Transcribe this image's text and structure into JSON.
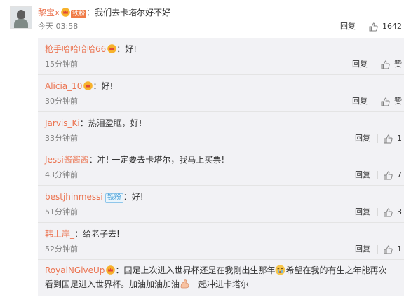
{
  "main_comment": {
    "username": "黎宝x",
    "badge_text": "铁粉",
    "separator": "：",
    "text": "我们去卡塔尔好不好",
    "time": "今天 03:58",
    "reply_label": "回复",
    "like_count": "1642"
  },
  "replies": [
    {
      "username": "枪手哈哈哈哈66",
      "separator": "：",
      "text": "好!",
      "time": "15分钟前",
      "reply_label": "回复",
      "like_label": "赞",
      "crown": true
    },
    {
      "username": "Alicia_10",
      "separator": "：",
      "text": "好!",
      "time": "30分钟前",
      "reply_label": "回复",
      "like_label": "赞",
      "crown": true
    },
    {
      "username": "Jarvis_Ki",
      "separator": "：",
      "text": "热泪盈眶，好!",
      "time": "33分钟前",
      "reply_label": "回复",
      "like_label": "1"
    },
    {
      "username": "Jessi酱酱酱",
      "separator": "：",
      "text": "冲! 一定要去卡塔尔，我马上买票!",
      "time": "43分钟前",
      "reply_label": "回复",
      "like_label": "7"
    },
    {
      "username": "bestjhinmessi",
      "badge_text": "铁粉",
      "separator": "：",
      "text": "好!",
      "time": "51分钟前",
      "reply_label": "回复",
      "like_label": "3"
    },
    {
      "username": "韩上岸_",
      "separator": "：",
      "text": "给老子去!",
      "time": "52分钟前",
      "reply_label": "回复",
      "like_label": "1"
    },
    {
      "username": "RoyalNGiveUp",
      "separator": "：",
      "text_a": "国足上次进入世界杯还是在我刚出生那年",
      "text_b": "希望在我的有生之年能再次",
      "text_c": "看到国足进入世界杯。加油加油加油",
      "text_d": "一起冲进卡塔尔",
      "crown": true
    }
  ],
  "colors": {
    "username": "#eb7350",
    "meta": "#808080",
    "sub_bg": "#f2f2f5"
  }
}
